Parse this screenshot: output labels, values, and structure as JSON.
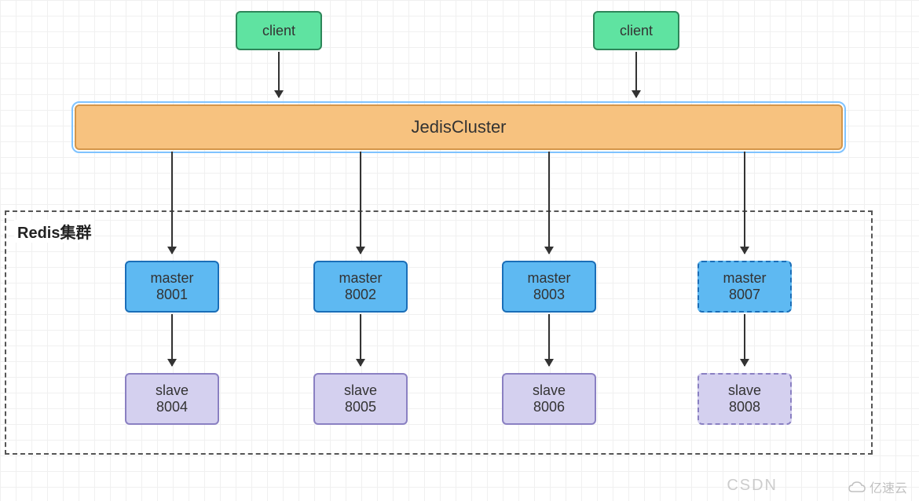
{
  "clients": [
    {
      "label": "client"
    },
    {
      "label": "client"
    }
  ],
  "middleware": {
    "label": "JedisCluster"
  },
  "group": {
    "label": "Redis集群"
  },
  "nodes": [
    {
      "master_label": "master",
      "master_port": "8001",
      "slave_label": "slave",
      "slave_port": "8004",
      "dashed": false
    },
    {
      "master_label": "master",
      "master_port": "8002",
      "slave_label": "slave",
      "slave_port": "8005",
      "dashed": false
    },
    {
      "master_label": "master",
      "master_port": "8003",
      "slave_label": "slave",
      "slave_port": "8006",
      "dashed": false
    },
    {
      "master_label": "master",
      "master_port": "8007",
      "slave_label": "slave",
      "slave_port": "8008",
      "dashed": true
    }
  ],
  "watermarks": {
    "csdn": "CSDN",
    "cloud": "亿速云"
  }
}
